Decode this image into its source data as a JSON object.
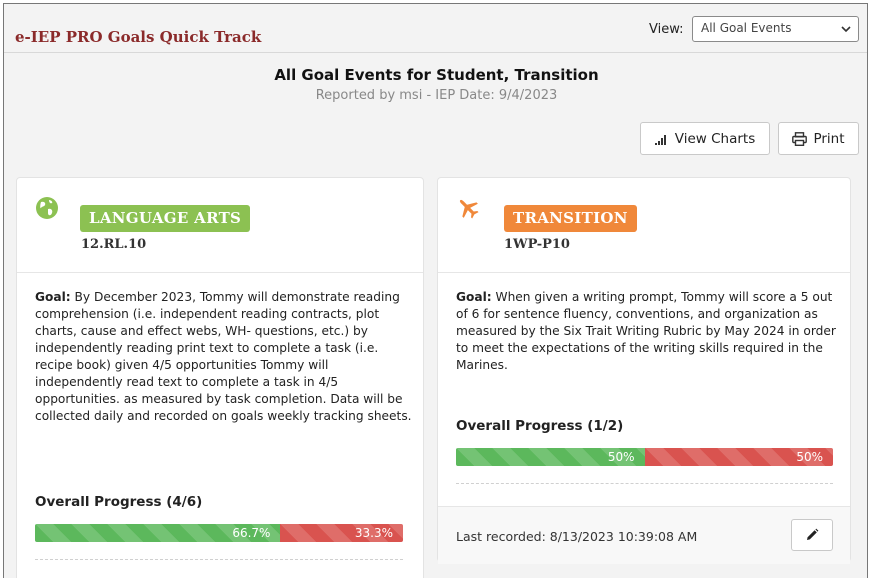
{
  "app": {
    "title": "e-IEP PRO Goals Quick Track"
  },
  "view": {
    "label": "View:",
    "selected": "All Goal Events"
  },
  "header": {
    "title": "All Goal Events for Student, Transition",
    "subtitle": "Reported by msi - IEP Date: 9/4/2023"
  },
  "toolbar": {
    "charts_label": "View Charts",
    "charts_icon": "bar-chart-icon",
    "print_label": "Print",
    "print_icon": "printer-icon"
  },
  "colors": {
    "brand": "#8b2a2a",
    "language_arts": "#8cc152",
    "transition": "#f0883a",
    "progress_met": "#5cb85c",
    "progress_not_met": "#d9534f"
  },
  "cards": [
    {
      "icon": "globe-icon",
      "subject": "LANGUAGE ARTS",
      "code": "12.RL.10",
      "goal_label": "Goal:",
      "goal_text": " By December 2023, Tommy will demonstrate reading comprehension (i.e. independent reading contracts, plot charts, cause and effect webs, WH- questions, etc.) by independently reading print text to complete a task (i.e. recipe book) given 4/5 opportunities Tommy will independently read text to complete a task in 4/5 opportunities. as measured by task completion. Data will be collected daily and recorded on goals weekly tracking sheets.",
      "progress_label": "Overall Progress (4/6)",
      "progress": {
        "met_fraction": 0.667,
        "met_text": "66.7%",
        "not_met_text": "33.3%"
      }
    },
    {
      "icon": "plane-icon",
      "subject": "TRANSITION",
      "code": "1WP-P10",
      "goal_label": "Goal:",
      "goal_text": " When given a writing prompt, Tommy will score a 5 out of 6 for sentence fluency, conventions, and organization as measured by the Six Trait Writing Rubric by May 2024 in order to meet the expectations of the writing skills required in the Marines.",
      "progress_label": "Overall Progress (1/2)",
      "progress": {
        "met_fraction": 0.5,
        "met_text": "50%",
        "not_met_text": "50%"
      },
      "last_recorded": "Last recorded: 8/13/2023 10:39:08 AM",
      "edit_icon": "pencil-icon"
    }
  ]
}
